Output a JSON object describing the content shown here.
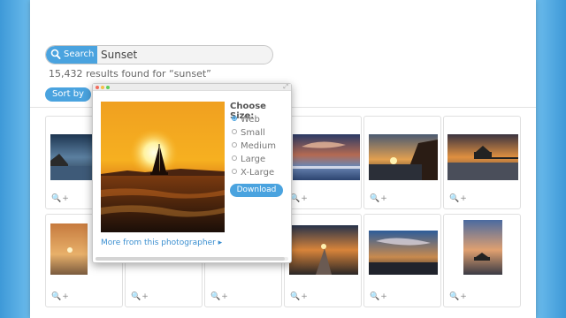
{
  "search": {
    "button_label": "Search",
    "query": "Sunset",
    "results_text": "15,432 results found for “sunset”"
  },
  "sort": {
    "label": "Sort by"
  },
  "grid": {
    "tool_zoom": "🔍",
    "tool_add": "+"
  },
  "popup": {
    "choose_label": "Choose Size:",
    "sizes": [
      "Web",
      "Small",
      "Medium",
      "Large",
      "X-Large"
    ],
    "selected_size": "Web",
    "download_label": "Download",
    "more_link": "More from this photographer ▸"
  },
  "colors": {
    "accent": "#4aa3df",
    "background": "#64b4e8"
  }
}
